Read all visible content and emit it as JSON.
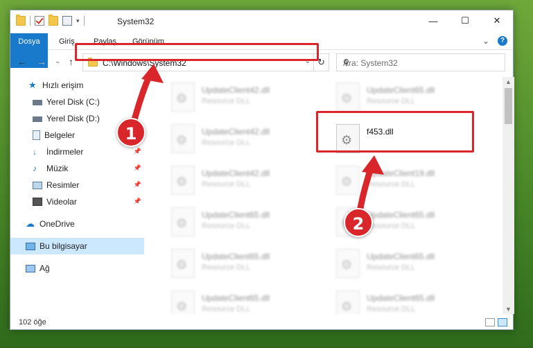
{
  "window": {
    "title": "System32",
    "controls": {
      "minimize": "—",
      "maximize": "☐",
      "close": "✕"
    }
  },
  "ribbon": {
    "tabs": [
      {
        "label": "Dosya"
      },
      {
        "label": "Giriş"
      },
      {
        "label": "Paylaş"
      },
      {
        "label": "Görünüm"
      }
    ],
    "expand_glyph": "⌄",
    "help_glyph": "?"
  },
  "navbar": {
    "back_glyph": "←",
    "forward_glyph": "→",
    "recent_glyph": "⌄",
    "up_glyph": "↑",
    "address_path": "C:\\Windows\\System32",
    "address_dropdown_glyph": "⌄",
    "refresh_glyph": "↻",
    "search_placeholder": "Ara: System32",
    "search_glyph": "⚲"
  },
  "sidebar": {
    "items": [
      {
        "label": "Hızlı erişim",
        "icon": "star-icon",
        "pinned": false
      },
      {
        "label": "Yerel Disk (C:)",
        "icon": "drive-icon",
        "pinned": false
      },
      {
        "label": "Yerel Disk (D:)",
        "icon": "drive-icon",
        "pinned": false
      },
      {
        "label": "Belgeler",
        "icon": "document-icon",
        "pinned": false
      },
      {
        "label": "İndirmeler",
        "icon": "download-icon",
        "pinned": true
      },
      {
        "label": "Müzik",
        "icon": "music-icon",
        "pinned": true
      },
      {
        "label": "Resimler",
        "icon": "pictures-icon",
        "pinned": true
      },
      {
        "label": "Videolar",
        "icon": "video-icon",
        "pinned": true
      },
      {
        "label": "OneDrive",
        "icon": "cloud-icon",
        "pinned": false
      },
      {
        "label": "Bu bilgisayar",
        "icon": "computer-icon",
        "pinned": false
      },
      {
        "label": "Ağ",
        "icon": "network-icon",
        "pinned": false
      }
    ],
    "pin_glyph": "📌"
  },
  "files": {
    "items": [
      {
        "name": "UpdateClient42.dll",
        "type": "Resource DLL"
      },
      {
        "name": "UpdateClient65.dll",
        "type": "Resource DLL"
      },
      {
        "name": "UpdateClient42.dll",
        "type": "Resource DLL"
      },
      {
        "name": "f453.dll",
        "type": ""
      },
      {
        "name": "UpdateClient42.dll",
        "type": "Resource DLL"
      },
      {
        "name": "UpdateClient19.dll",
        "type": "Resource DLL"
      },
      {
        "name": "UpdateClient65.dll",
        "type": "Resource DLL"
      },
      {
        "name": "UpdateClient65.dll",
        "type": "Resource DLL"
      },
      {
        "name": "UpdateClient65.dll",
        "type": "Resource DLL"
      },
      {
        "name": "UpdateClient65.dll",
        "type": "Resource DLL"
      },
      {
        "name": "UpdateClient65.dll",
        "type": "Resource DLL"
      },
      {
        "name": "UpdateClient65.dll",
        "type": "Resource DLL"
      }
    ]
  },
  "annotations": {
    "marker1": "1",
    "marker2": "2",
    "highlight_color": "#d9262a"
  },
  "statusbar": {
    "item_count": "102 öğe"
  },
  "colors": {
    "accent": "#1979ca",
    "selection": "#cce8ff"
  }
}
